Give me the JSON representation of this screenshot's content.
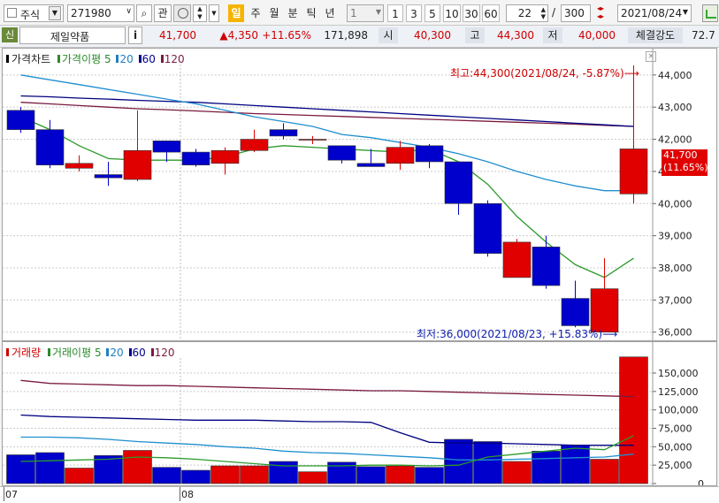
{
  "toolbar": {
    "market": "주식",
    "code": "271980",
    "btn_interest": "관",
    "periods": [
      "일",
      "주",
      "월",
      "분",
      "틱",
      "년"
    ],
    "unit_value": "1",
    "minute_options": [
      "1",
      "3",
      "5",
      "10",
      "30",
      "60"
    ],
    "count_value": "22",
    "slash": "/",
    "total_value": "300",
    "date_value": "2021/08/24"
  },
  "quote": {
    "badge": "신",
    "name": "제일약품",
    "info_btn": "i",
    "price": "41,700",
    "change": "▲4,350",
    "change_pct": "+11.65%",
    "volume": "171,898",
    "open_label": "시",
    "open": "40,300",
    "high_label": "고",
    "high": "44,300",
    "low_label": "저",
    "low": "40,000",
    "strength_label": "체결강도",
    "strength": "72.7"
  },
  "price_panel": {
    "legend": [
      {
        "text": "가격차트",
        "color": "#000000"
      },
      {
        "text": "가격이평",
        "color": "#2a8a2a"
      },
      {
        "text": "5",
        "color": "#2a8a2a"
      },
      {
        "text": "20",
        "color": "#1f7fc0"
      },
      {
        "text": "60",
        "color": "#000090"
      },
      {
        "text": "120",
        "color": "#7a1a40"
      }
    ],
    "high_note": "최고:44,300(2021/08/24, -5.87%)⟶",
    "low_note": "최저:36,000(2021/08/23, +15.83%)⟶",
    "last_price_tag": "41,700",
    "last_pct_tag": "(11.65%)"
  },
  "volume_panel": {
    "legend": [
      {
        "text": "거래량",
        "color": "#cc0000"
      },
      {
        "text": "거래이평",
        "color": "#2a8a2a"
      },
      {
        "text": "5",
        "color": "#2a8a2a"
      },
      {
        "text": "20",
        "color": "#1f7fc0"
      },
      {
        "text": "60",
        "color": "#000090"
      },
      {
        "text": "120",
        "color": "#7a1a40"
      }
    ]
  },
  "date_labels": [
    "07",
    "08"
  ],
  "colors": {
    "up": "#e00000",
    "down": "#0000cc",
    "ma5": "#2a9a2a",
    "ma20": "#1f8fcf",
    "ma60": "#000080",
    "ma120": "#7a1a40"
  },
  "chart_data": {
    "type": "candlestick",
    "price_ylim": [
      35800,
      44600
    ],
    "price_ticks": [
      36000,
      37000,
      38000,
      39000,
      40000,
      41000,
      42000,
      43000,
      44000
    ],
    "volume_ylim": [
      0,
      180000
    ],
    "volume_ticks": [
      0,
      25000,
      50000,
      75000,
      100000,
      125000,
      150000
    ],
    "candles": [
      {
        "o": 42900,
        "h": 43000,
        "l": 42200,
        "c": 42300
      },
      {
        "o": 42300,
        "h": 42600,
        "l": 41100,
        "c": 41200
      },
      {
        "o": 41100,
        "h": 41500,
        "l": 41000,
        "c": 41250
      },
      {
        "o": 40900,
        "h": 41300,
        "l": 40550,
        "c": 40800
      },
      {
        "o": 40750,
        "h": 42900,
        "l": 40700,
        "c": 41650
      },
      {
        "o": 41950,
        "h": 41950,
        "l": 41300,
        "c": 41600
      },
      {
        "o": 41600,
        "h": 41700,
        "l": 41150,
        "c": 41200
      },
      {
        "o": 41250,
        "h": 41750,
        "l": 40900,
        "c": 41650
      },
      {
        "o": 41650,
        "h": 42300,
        "l": 41600,
        "c": 42000
      },
      {
        "o": 42300,
        "h": 42500,
        "l": 42000,
        "c": 42100
      },
      {
        "o": 42000,
        "h": 42100,
        "l": 41850,
        "c": 42000
      },
      {
        "o": 41800,
        "h": 41800,
        "l": 41250,
        "c": 41350
      },
      {
        "o": 41250,
        "h": 41700,
        "l": 41150,
        "c": 41150
      },
      {
        "o": 41250,
        "h": 41950,
        "l": 41050,
        "c": 41750
      },
      {
        "o": 41800,
        "h": 41850,
        "l": 41100,
        "c": 41300
      },
      {
        "o": 41300,
        "h": 41300,
        "l": 39650,
        "c": 40000
      },
      {
        "o": 40000,
        "h": 40100,
        "l": 38350,
        "c": 38450
      },
      {
        "o": 37700,
        "h": 38900,
        "l": 37700,
        "c": 38800
      },
      {
        "o": 38650,
        "h": 39000,
        "l": 37350,
        "c": 37450
      },
      {
        "o": 37050,
        "h": 37600,
        "l": 36150,
        "c": 36200
      },
      {
        "o": 36000,
        "h": 38300,
        "l": 36000,
        "c": 37350
      },
      {
        "o": 40300,
        "h": 44300,
        "l": 40000,
        "c": 41700
      }
    ],
    "volume": [
      39000,
      42000,
      21000,
      38000,
      45000,
      22000,
      18000,
      24000,
      24000,
      30000,
      16000,
      29000,
      23000,
      24000,
      22000,
      60000,
      57000,
      30000,
      44000,
      52000,
      33000,
      171898
    ],
    "ma5_price": [
      42700,
      42300,
      41800,
      41400,
      41350,
      41350,
      41350,
      41450,
      41700,
      41800,
      41750,
      41700,
      41650,
      41600,
      41700,
      41300,
      40600,
      39600,
      38800,
      38100,
      37700,
      38300
    ],
    "ma20_price": [
      44000,
      43850,
      43700,
      43550,
      43400,
      43250,
      43100,
      42900,
      42700,
      42550,
      42400,
      42150,
      42050,
      41900,
      41750,
      41550,
      41300,
      41000,
      40750,
      40550,
      40400,
      40400
    ],
    "ma60_price": [
      43350,
      43320,
      43280,
      43250,
      43210,
      43180,
      43150,
      43100,
      43050,
      43000,
      42950,
      42900,
      42850,
      42800,
      42750,
      42700,
      42650,
      42600,
      42550,
      42500,
      42450,
      42400
    ],
    "ma120_price": [
      43150,
      43100,
      43050,
      43000,
      42950,
      42920,
      42880,
      42840,
      42800,
      42770,
      42740,
      42710,
      42680,
      42650,
      42620,
      42590,
      42560,
      42530,
      42500,
      42470,
      42430,
      42400
    ],
    "ma5_vol": [
      30000,
      31000,
      32000,
      33000,
      36000,
      35000,
      33000,
      30000,
      27000,
      24000,
      24000,
      24000,
      25000,
      25000,
      24000,
      25000,
      36000,
      40000,
      44000,
      48000,
      46000,
      65000
    ],
    "ma20_vol": [
      63000,
      63000,
      62000,
      60000,
      57000,
      55000,
      53000,
      50000,
      48000,
      44000,
      42000,
      41000,
      39000,
      37000,
      35000,
      32000,
      32000,
      33000,
      34000,
      35000,
      36000,
      40000
    ],
    "ma60_vol": [
      93000,
      91000,
      90000,
      89000,
      88000,
      87000,
      86000,
      86000,
      86000,
      85000,
      84000,
      84000,
      83000,
      69000,
      56000,
      55000,
      55000,
      54000,
      53000,
      52000,
      52000,
      52000
    ],
    "ma120_vol": [
      140000,
      136000,
      135000,
      134000,
      133000,
      133000,
      132000,
      131000,
      130000,
      129000,
      128000,
      127000,
      126000,
      126000,
      125000,
      124000,
      123000,
      122000,
      121000,
      120000,
      119000,
      118000
    ],
    "x_labels": [
      {
        "index": 0,
        "text": "07"
      },
      {
        "index": 6,
        "text": "08"
      }
    ]
  }
}
